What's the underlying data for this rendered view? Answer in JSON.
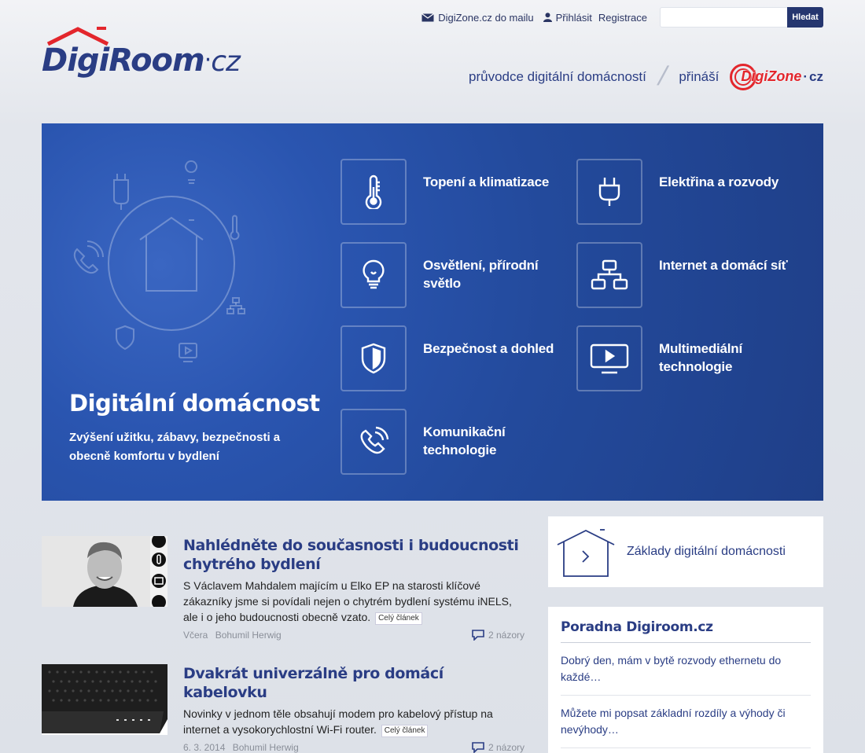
{
  "topbar": {
    "mail_label": "DigiZone.cz do mailu",
    "login_label": "Přihlásit",
    "register_label": "Registrace",
    "search_placeholder": "",
    "search_button": "Hledat"
  },
  "logo": {
    "name": "DigiRoom",
    "dot": "·",
    "tld": "cz"
  },
  "tagline": {
    "guide": "průvodce digitální domácností",
    "brings": "přináší",
    "partner_name": "DigiZone",
    "partner_dot": "·",
    "partner_tld": "cz"
  },
  "hero": {
    "title": "Digitální domácnost",
    "subtitle": "Zvýšení užitku, zábavy, bezpečnosti a obecně komfortu v bydlení",
    "categories": [
      {
        "label": "Topení a klimatizace",
        "icon": "thermometer-icon"
      },
      {
        "label": "Elektřina a rozvody",
        "icon": "plug-icon"
      },
      {
        "label": "Osvětlení, přírodní světlo",
        "icon": "lightbulb-icon"
      },
      {
        "label": "Internet a domácí síť",
        "icon": "network-icon"
      },
      {
        "label": "Bezpečnost a dohled",
        "icon": "shield-icon"
      },
      {
        "label": "Multimediální technologie",
        "icon": "tv-play-icon"
      },
      {
        "label": "Komunikační technologie",
        "icon": "phone-icon"
      }
    ]
  },
  "articles": [
    {
      "title": "Nahlédněte do současnosti i budoucnosti chytrého bydlení",
      "text": "S Václavem Mahdalem majícím u Elko EP na starosti klíčové zákazníky jsme si povídali nejen o chytrém bydlení systému iNELS, ale i o jeho budoucnosti obecně vzato.",
      "more": "Celý článek",
      "date": "Včera",
      "author": "Bohumil Herwig",
      "comments": "2 názory"
    },
    {
      "title": "Dvakrát univerzálně pro domácí kabelovku",
      "text": "Novinky v jednom těle obsahují modem pro kabelový přístup na internet a vysokorychlostní Wi-Fi router.",
      "more": "Celý článek",
      "date": "6. 3. 2014",
      "author": "Bohumil Herwig",
      "comments": "2 názory"
    }
  ],
  "sidebar": {
    "basics_label": "Základy digitální domácnosti",
    "poradna_title": "Poradna Digiroom.cz",
    "poradna_items": [
      "Dobrý den, mám v bytě rozvody ethernetu do každé…",
      "Můžete mi popsat základní rozdíly a výhody či nevýhody…"
    ]
  },
  "colors": {
    "brand_blue": "#2a3d84",
    "hero_blue": "#234a9c",
    "accent_red": "#e3262c"
  }
}
